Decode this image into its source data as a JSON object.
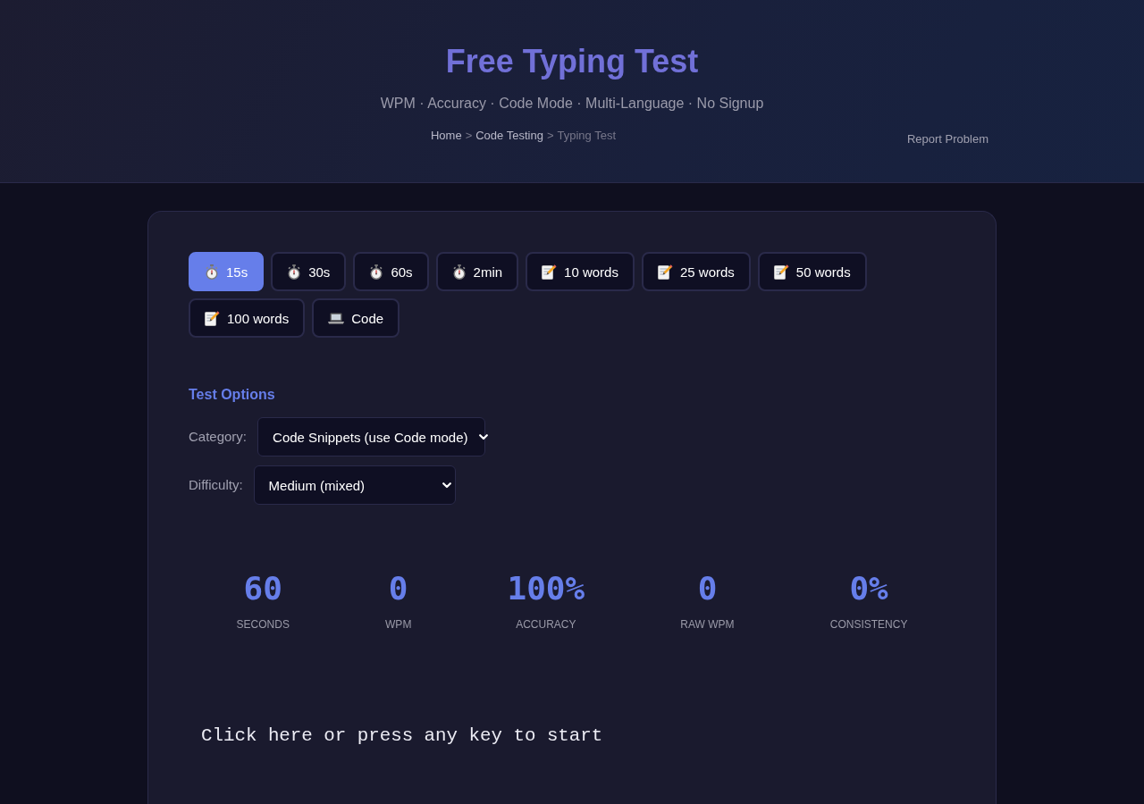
{
  "header": {
    "title": "Free Typing Test",
    "subtitle": "WPM · Accuracy · Code Mode · Multi-Language · No Signup",
    "breadcrumb": {
      "separator": ">",
      "items": [
        {
          "label": "Home",
          "kind": "link"
        },
        {
          "label": "Code Testing",
          "kind": "link"
        },
        {
          "label": "Typing Test",
          "kind": "current"
        }
      ]
    },
    "report_link": "Report Problem"
  },
  "modes": [
    {
      "kind": "timer",
      "label": "15s",
      "selected": true
    },
    {
      "kind": "timer",
      "label": "30s",
      "selected": false
    },
    {
      "kind": "timer",
      "label": "60s",
      "selected": false
    },
    {
      "kind": "timer",
      "label": "2min",
      "selected": false
    },
    {
      "kind": "words",
      "label": "10 words",
      "selected": false
    },
    {
      "kind": "words",
      "label": "25 words",
      "selected": false
    },
    {
      "kind": "words",
      "label": "50 words",
      "selected": false
    },
    {
      "kind": "words",
      "label": "100 words",
      "selected": false
    },
    {
      "kind": "code",
      "label": "Code",
      "selected": false
    }
  ],
  "test_options": {
    "title": "Test Options",
    "fields": [
      {
        "label": "Category:",
        "value": "Code Snippets (use Code mode)"
      },
      {
        "label": "Difficulty:",
        "value": "Medium (mixed)"
      }
    ]
  },
  "stats": [
    {
      "value": "60",
      "label": "SECONDS"
    },
    {
      "value": "0",
      "label": "WPM"
    },
    {
      "value": "100%",
      "label": "ACCURACY"
    },
    {
      "value": "0",
      "label": "RAW WPM"
    },
    {
      "value": "0%",
      "label": "CONSISTENCY"
    }
  ],
  "prompt": "Click here or press any key to start"
}
